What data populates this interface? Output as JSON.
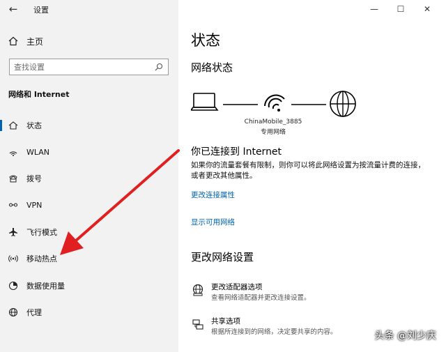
{
  "app": {
    "title": "设置"
  },
  "sidebar": {
    "home_label": "主页",
    "search_placeholder": "查找设置",
    "section": "网络和 Internet",
    "items": [
      {
        "label": "状态",
        "icon": "home-status-icon",
        "selected": true
      },
      {
        "label": "WLAN",
        "icon": "wifi-icon"
      },
      {
        "label": "拨号",
        "icon": "dialup-icon"
      },
      {
        "label": "VPN",
        "icon": "vpn-icon"
      },
      {
        "label": "飞行模式",
        "icon": "airplane-icon"
      },
      {
        "label": "移动热点",
        "icon": "hotspot-icon"
      },
      {
        "label": "数据使用量",
        "icon": "data-usage-icon"
      },
      {
        "label": "代理",
        "icon": "globe-icon"
      }
    ]
  },
  "main": {
    "title": "状态",
    "network_status_heading": "网络状态",
    "network_name": "ChinaMobile_3885",
    "network_type": "专用网络",
    "connected_heading": "你已连接到 Internet",
    "connected_desc": "如果你的流量套餐有限制，则你可以将此网络设置为按流量计费的连接，或者更改其他属性。",
    "link_change_props": "更改连接属性",
    "link_show_networks": "显示可用网络",
    "change_heading": "更改网络设置",
    "options": [
      {
        "title": "更改适配器选项",
        "desc": "查看网络适配器并更改连接设置。"
      },
      {
        "title": "共享选项",
        "desc": "根据所连接到的网络，决定要共享的内容。"
      }
    ]
  },
  "watermark": "头条 @刘少庆",
  "colors": {
    "accent": "#0063b1",
    "sidebar_bg": "#f2f2f2",
    "arrow": "#e02020"
  }
}
